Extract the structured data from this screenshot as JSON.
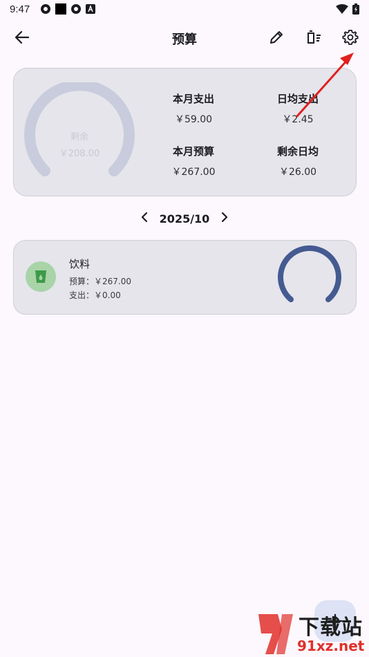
{
  "status_bar": {
    "time": "9:47"
  },
  "app_bar": {
    "title": "预算"
  },
  "summary": {
    "gauge_label": "剩余",
    "gauge_value": "￥208.00",
    "stats": [
      {
        "label": "本月支出",
        "value": "￥59.00"
      },
      {
        "label": "日均支出",
        "value": "￥2.45"
      },
      {
        "label": "本月预算",
        "value": "￥267.00"
      },
      {
        "label": "剩余日均",
        "value": "￥26.00"
      }
    ]
  },
  "month_selector": {
    "label": "2025/10"
  },
  "categories": [
    {
      "name": "饮料",
      "budget": "预算：￥267.00",
      "spent": "支出：￥0.00",
      "progress": 1.0
    }
  ],
  "watermark": {
    "top": "下载站",
    "bottom": "91xz.net"
  },
  "colors": {
    "accent": "#455a91",
    "gauge_track": "#c8ccdc",
    "category_icon_bg": "#a8d4a8",
    "category_icon_fg": "#3e9a48",
    "annotation_arrow": "#e02020"
  }
}
